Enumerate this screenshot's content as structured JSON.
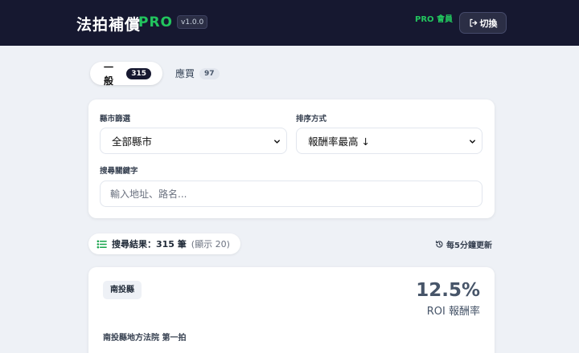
{
  "header": {
    "title": "法拍補償",
    "pro": "PRO",
    "version": "v1.0.0",
    "member": "PRO 會員",
    "switch_label": "切換"
  },
  "tabs": [
    {
      "label": "一般",
      "count": "315",
      "active": true
    },
    {
      "label": "應買",
      "count": "97",
      "active": false
    }
  ],
  "filters": {
    "county_label": "縣市篩選",
    "county_value": "全部縣市",
    "sort_label": "排序方式",
    "sort_value": "報酬率最高 ↓",
    "keyword_label": "搜尋關鍵字",
    "keyword_placeholder": "輸入地址、路名..."
  },
  "results": {
    "summary": "搜尋結果：315 筆",
    "shown": "(顯示 20)",
    "update_note": "每5分鐘更新"
  },
  "card": {
    "county": "南投縣",
    "roi_value": "12.5%",
    "roi_label": "ROI 報酬率",
    "court": "南投縣地方法院 第一拍"
  },
  "colors": {
    "header_bg": "#161830",
    "accent_green": "#22c55e",
    "page_bg": "#eef1f6"
  }
}
